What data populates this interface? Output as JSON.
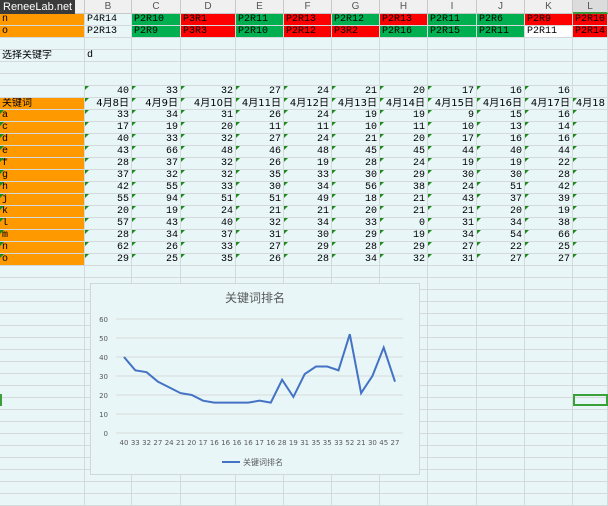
{
  "brand": "ReneeLab.net",
  "columns": [
    "",
    "B",
    "C",
    "D",
    "E",
    "F",
    "G",
    "H",
    "I",
    "J",
    "K",
    "L"
  ],
  "rank_rows": [
    {
      "label": "n",
      "cells": [
        "P4R14",
        "P2R10",
        "P3R1",
        "P2R11",
        "P2R13",
        "P2R12",
        "P2R13",
        "P2R11",
        "P2R6",
        "P2R9",
        "P2R10"
      ],
      "colors": [
        "none",
        "green",
        "red",
        "green",
        "red",
        "green",
        "red",
        "green",
        "green",
        "red",
        "red"
      ]
    },
    {
      "label": "o",
      "cells": [
        "P2R13",
        "P2R9",
        "P3R3",
        "P2R10",
        "P2R12",
        "P3R2",
        "P2R16",
        "P2R15",
        "P2R11",
        "P2R11",
        "P2R14"
      ],
      "colors": [
        "none",
        "green",
        "red",
        "green",
        "red",
        "red",
        "green",
        "green",
        "green",
        "white",
        "red"
      ]
    }
  ],
  "select": {
    "label": "选择关键字",
    "value": "d"
  },
  "selected_values": [
    "40",
    "33",
    "32",
    "27",
    "24",
    "21",
    "20",
    "17",
    "16",
    "16"
  ],
  "header": {
    "label": "关键词",
    "dates": [
      "4月8日",
      "4月9日",
      "4月10日",
      "4月11日",
      "4月12日",
      "4月13日",
      "4月14日",
      "4月15日",
      "4月16日",
      "4月17日",
      "4月18"
    ]
  },
  "keywords": [
    {
      "name": "a",
      "values": [
        "33",
        "34",
        "31",
        "26",
        "24",
        "19",
        "19",
        "9",
        "15",
        "16"
      ]
    },
    {
      "name": "c",
      "values": [
        "17",
        "19",
        "20",
        "11",
        "11",
        "10",
        "11",
        "10",
        "13",
        "14"
      ]
    },
    {
      "name": "d",
      "values": [
        "40",
        "33",
        "32",
        "27",
        "24",
        "21",
        "20",
        "17",
        "16",
        "16"
      ]
    },
    {
      "name": "e",
      "values": [
        "43",
        "66",
        "48",
        "46",
        "48",
        "45",
        "45",
        "44",
        "40",
        "44"
      ]
    },
    {
      "name": "f",
      "values": [
        "28",
        "37",
        "32",
        "26",
        "19",
        "28",
        "24",
        "19",
        "19",
        "22"
      ]
    },
    {
      "name": "g",
      "values": [
        "37",
        "32",
        "32",
        "35",
        "33",
        "30",
        "29",
        "30",
        "30",
        "28"
      ]
    },
    {
      "name": "h",
      "values": [
        "42",
        "55",
        "33",
        "30",
        "34",
        "56",
        "38",
        "24",
        "51",
        "42"
      ]
    },
    {
      "name": "j",
      "values": [
        "55",
        "94",
        "51",
        "51",
        "49",
        "18",
        "21",
        "43",
        "37",
        "39"
      ]
    },
    {
      "name": "k",
      "values": [
        "20",
        "19",
        "24",
        "21",
        "21",
        "20",
        "21",
        "21",
        "20",
        "19"
      ]
    },
    {
      "name": "l",
      "values": [
        "57",
        "43",
        "40",
        "32",
        "34",
        "33",
        "0",
        "31",
        "34",
        "38"
      ]
    },
    {
      "name": "m",
      "values": [
        "28",
        "34",
        "37",
        "31",
        "30",
        "29",
        "19",
        "34",
        "54",
        "66"
      ]
    },
    {
      "name": "n",
      "values": [
        "62",
        "26",
        "33",
        "27",
        "29",
        "28",
        "29",
        "27",
        "22",
        "25"
      ]
    },
    {
      "name": "o",
      "values": [
        "29",
        "25",
        "35",
        "26",
        "28",
        "34",
        "32",
        "31",
        "27",
        "27"
      ]
    }
  ],
  "colors": {
    "orange": "#ff9900",
    "green": "#00b050",
    "red": "#ff0000",
    "line": "#4472c4"
  },
  "chart_data": {
    "type": "line",
    "title": "关键词排名",
    "x": [
      "40",
      "33",
      "32",
      "27",
      "24",
      "21",
      "20",
      "17",
      "16",
      "16",
      "16",
      "16",
      "17",
      "16",
      "28",
      "19",
      "31",
      "35",
      "35",
      "33",
      "52",
      "21",
      "30",
      "45",
      "27"
    ],
    "series": [
      {
        "name": "关键词排名",
        "values": [
          40,
          33,
          32,
          27,
          24,
          21,
          20,
          17,
          16,
          16,
          16,
          16,
          17,
          16,
          28,
          19,
          31,
          35,
          35,
          33,
          52,
          21,
          30,
          45,
          27
        ]
      }
    ],
    "yticks": [
      "0",
      "10",
      "20",
      "30",
      "40",
      "50",
      "60"
    ],
    "ylim": [
      0,
      60
    ],
    "grid": true,
    "legend": "bottom"
  }
}
